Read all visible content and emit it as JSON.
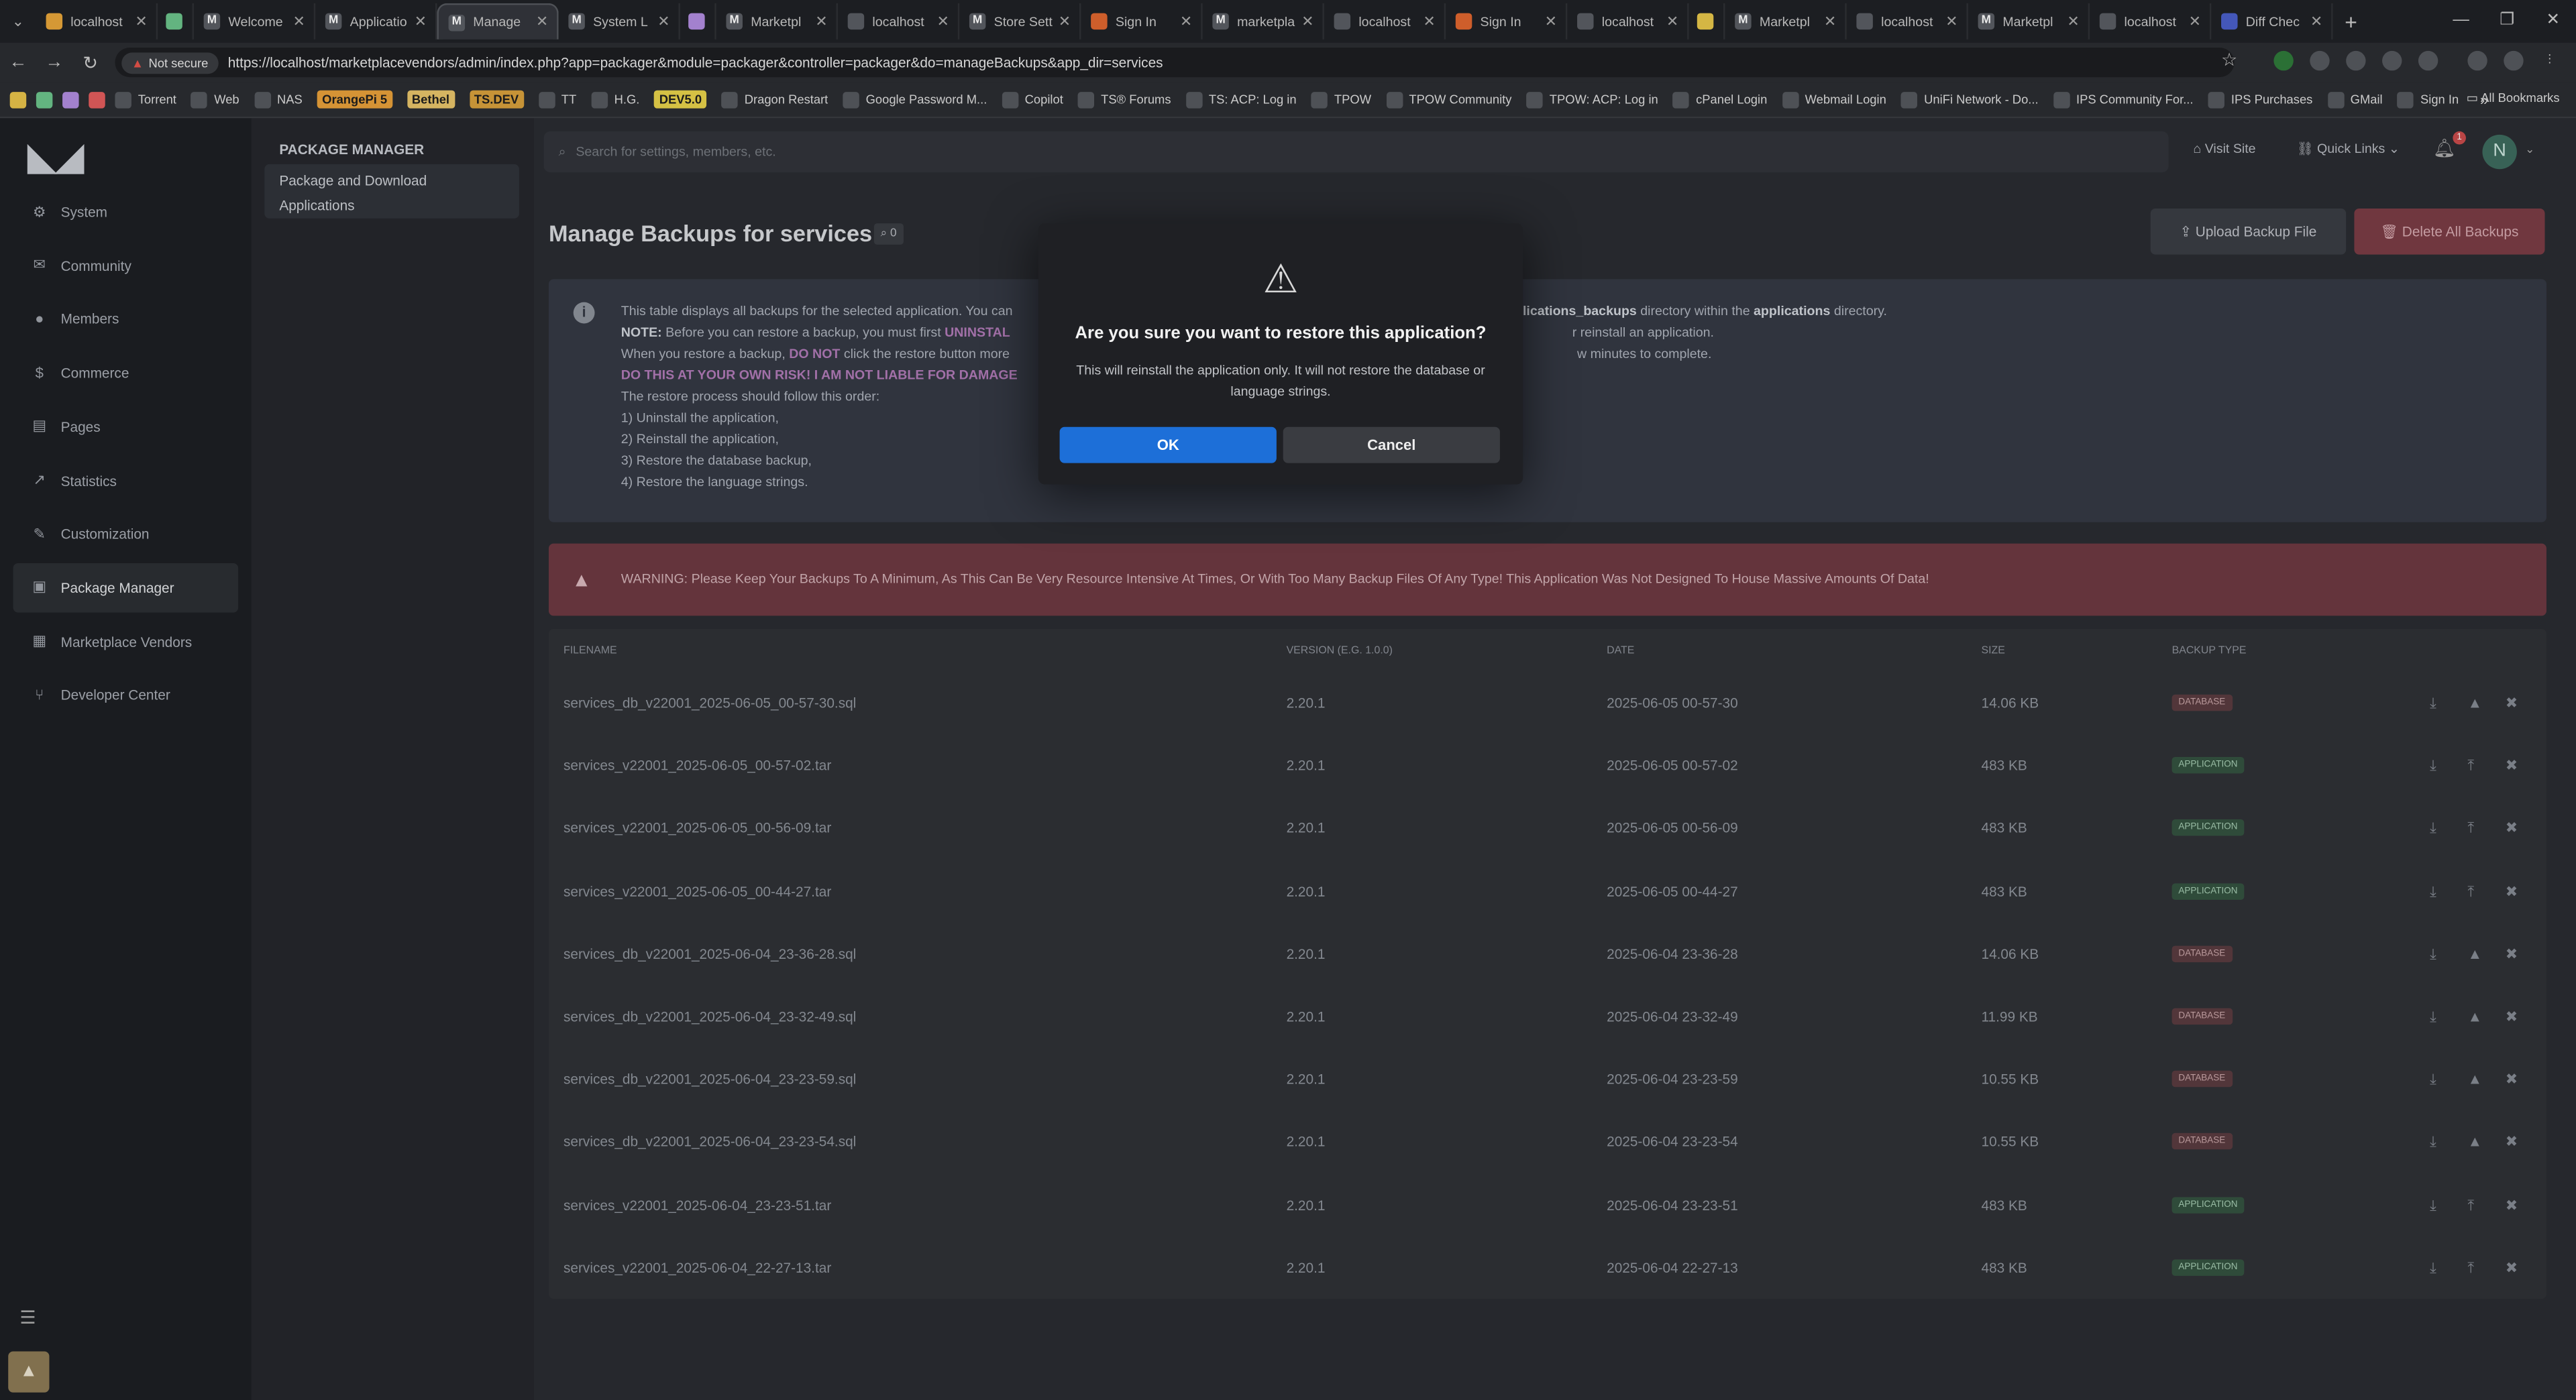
{
  "browser": {
    "tabs": [
      {
        "title": "localhost",
        "icon": "lambda-icon",
        "color": "#e8a53a"
      },
      {
        "title": "",
        "icon": "square-icon",
        "color": "#6cc48b"
      },
      {
        "title": "Welcome",
        "icon": "m-icon",
        "color": "#5a5d63"
      },
      {
        "title": "Applicatio",
        "icon": "m-icon",
        "color": "#5a5d63"
      },
      {
        "title": "Manage",
        "icon": "m-icon",
        "color": "#5a5d63",
        "active": true
      },
      {
        "title": "System L",
        "icon": "m-icon",
        "color": "#5a5d63"
      },
      {
        "title": "",
        "icon": "square-icon",
        "color": "#b18de0"
      },
      {
        "title": "Marketpl",
        "icon": "m-icon",
        "color": "#5a5d63"
      },
      {
        "title": "localhost",
        "icon": "globe-icon",
        "color": "#5a5d63"
      },
      {
        "title": "Store Sett",
        "icon": "m-icon",
        "color": "#5a5d63"
      },
      {
        "title": "Sign In",
        "icon": "sign-in-icon",
        "color": "#e0662f"
      },
      {
        "title": "marketpla",
        "icon": "m-icon",
        "color": "#5a5d63"
      },
      {
        "title": "localhost",
        "icon": "globe-icon",
        "color": "#5a5d63"
      },
      {
        "title": "Sign In",
        "icon": "sign-in-icon",
        "color": "#e0662f"
      },
      {
        "title": "localhost",
        "icon": "globe-icon",
        "color": "#5a5d63"
      },
      {
        "title": "",
        "icon": "square-icon",
        "color": "#e7c64a"
      },
      {
        "title": "Marketpl",
        "icon": "m-icon",
        "color": "#5a5d63"
      },
      {
        "title": "localhost",
        "icon": "globe-icon",
        "color": "#5a5d63"
      },
      {
        "title": "Marketpl",
        "icon": "m-icon",
        "color": "#5a5d63"
      },
      {
        "title": "localhost",
        "icon": "globe-icon",
        "color": "#5a5d63"
      },
      {
        "title": "Diff Chec",
        "icon": "diff-icon",
        "color": "#4a5fc9"
      }
    ],
    "not_secure": "Not secure",
    "url": "https://localhost/marketplacevendors/admin/index.php?app=packager&module=packager&controller=packager&do=manageBackups&app_dir=services",
    "bookmarks": [
      {
        "label": "Torrent"
      },
      {
        "label": "Web"
      },
      {
        "label": "NAS"
      },
      {
        "label": "OrangePi 5",
        "color": "#e8a03a"
      },
      {
        "label": "Bethel",
        "color": "#e8c46a"
      },
      {
        "label": "TS.DEV",
        "color": "#d7a03c"
      },
      {
        "label": "TT"
      },
      {
        "label": "H.G."
      },
      {
        "label": "DEV5.0",
        "color": "#e8d24a"
      },
      {
        "label": "Dragon Restart"
      },
      {
        "label": "Google Password M..."
      },
      {
        "label": "Copilot"
      },
      {
        "label": "TS® Forums"
      },
      {
        "label": "TS: ACP: Log in"
      },
      {
        "label": "TPOW"
      },
      {
        "label": "TPOW Community"
      },
      {
        "label": "TPOW: ACP: Log in"
      },
      {
        "label": "cPanel Login"
      },
      {
        "label": "Webmail Login"
      },
      {
        "label": "UniFi Network - Do..."
      },
      {
        "label": "IPS Community For..."
      },
      {
        "label": "IPS Purchases"
      },
      {
        "label": "GMail"
      },
      {
        "label": "Sign In"
      }
    ],
    "all_bookmarks": "All Bookmarks"
  },
  "sidebar": {
    "items": [
      {
        "label": "System",
        "icon": "cogs-icon"
      },
      {
        "label": "Community",
        "icon": "comments-icon"
      },
      {
        "label": "Members",
        "icon": "user-icon"
      },
      {
        "label": "Commerce",
        "icon": "dollar-icon"
      },
      {
        "label": "Pages",
        "icon": "file-icon"
      },
      {
        "label": "Statistics",
        "icon": "chart-icon"
      },
      {
        "label": "Customization",
        "icon": "brush-icon"
      },
      {
        "label": "Package Manager",
        "icon": "archive-icon",
        "active": true
      },
      {
        "label": "Marketplace Vendors",
        "icon": "store-icon"
      },
      {
        "label": "Developer Center",
        "icon": "code-branch-icon"
      }
    ]
  },
  "subnav": {
    "heading": "PACKAGE MANAGER",
    "item_line1": "Package and Download",
    "item_line2": "Applications"
  },
  "header": {
    "search_placeholder": "Search for settings, members, etc.",
    "visit_site": "Visit Site",
    "quick_links": "Quick Links",
    "notifications_count": "1",
    "avatar_initial": "N"
  },
  "page": {
    "title": "Manage Backups for services",
    "badge": "0",
    "upload_button": "Upload Backup File",
    "delete_all_button": "Delete All Backups"
  },
  "info": {
    "line1_a": "This table displays all backups for the selected application. You can",
    "line1_b": "plications_backups",
    "line1_c": " directory within the ",
    "line1_d": "applications",
    "line1_e": " directory.",
    "line2_note": "NOTE:",
    "line2_a": " Before you can restore a backup, you must first ",
    "line2_hl": "UNINSTAL",
    "line2_b": "r reinstall an application.",
    "line3_a": "When you restore a backup, ",
    "line3_hl": "DO NOT",
    "line3_b": " click the restore button more",
    "line3_c": "w minutes to complete.",
    "line4": "DO THIS AT YOUR OWN RISK! I AM NOT LIABLE FOR DAMAGE",
    "line5": "The restore process should follow this order:",
    "steps": [
      "1) Uninstall the application,",
      "2) Reinstall the application,",
      "3) Restore the database backup,",
      "4) Restore the language strings."
    ]
  },
  "warning": "WARNING: Please Keep Your Backups To A Minimum, As This Can Be Very Resource Intensive At Times, Or With Too Many Backup Files Of Any Type! This Application Was Not Designed To House Massive Amounts Of Data!",
  "table": {
    "headers": [
      "FILENAME",
      "VERSION (E.G. 1.0.0)",
      "DATE",
      "SIZE",
      "BACKUP TYPE"
    ],
    "rows": [
      {
        "filename": "services_db_v22001_2025-06-05_00-57-30.sql",
        "version": "2.20.1",
        "date": "2025-06-05 00-57-30",
        "size": "14.06 KB",
        "type": "DATABASE"
      },
      {
        "filename": "services_v22001_2025-06-05_00-57-02.tar",
        "version": "2.20.1",
        "date": "2025-06-05 00-57-02",
        "size": "483 KB",
        "type": "APPLICATION"
      },
      {
        "filename": "services_v22001_2025-06-05_00-56-09.tar",
        "version": "2.20.1",
        "date": "2025-06-05 00-56-09",
        "size": "483 KB",
        "type": "APPLICATION"
      },
      {
        "filename": "services_v22001_2025-06-05_00-44-27.tar",
        "version": "2.20.1",
        "date": "2025-06-05 00-44-27",
        "size": "483 KB",
        "type": "APPLICATION"
      },
      {
        "filename": "services_db_v22001_2025-06-04_23-36-28.sql",
        "version": "2.20.1",
        "date": "2025-06-04 23-36-28",
        "size": "14.06 KB",
        "type": "DATABASE"
      },
      {
        "filename": "services_db_v22001_2025-06-04_23-32-49.sql",
        "version": "2.20.1",
        "date": "2025-06-04 23-32-49",
        "size": "11.99 KB",
        "type": "DATABASE"
      },
      {
        "filename": "services_db_v22001_2025-06-04_23-23-59.sql",
        "version": "2.20.1",
        "date": "2025-06-04 23-23-59",
        "size": "10.55 KB",
        "type": "DATABASE"
      },
      {
        "filename": "services_db_v22001_2025-06-04_23-23-54.sql",
        "version": "2.20.1",
        "date": "2025-06-04 23-23-54",
        "size": "10.55 KB",
        "type": "DATABASE"
      },
      {
        "filename": "services_v22001_2025-06-04_23-23-51.tar",
        "version": "2.20.1",
        "date": "2025-06-04 23-23-51",
        "size": "483 KB",
        "type": "APPLICATION"
      },
      {
        "filename": "services_v22001_2025-06-04_22-27-13.tar",
        "version": "2.20.1",
        "date": "2025-06-04 22-27-13",
        "size": "483 KB",
        "type": "APPLICATION"
      }
    ]
  },
  "modal": {
    "title": "Are you sure you want to restore this application?",
    "body": "This will reinstall the application only. It will not restore the database or language strings.",
    "ok": "OK",
    "cancel": "Cancel"
  }
}
